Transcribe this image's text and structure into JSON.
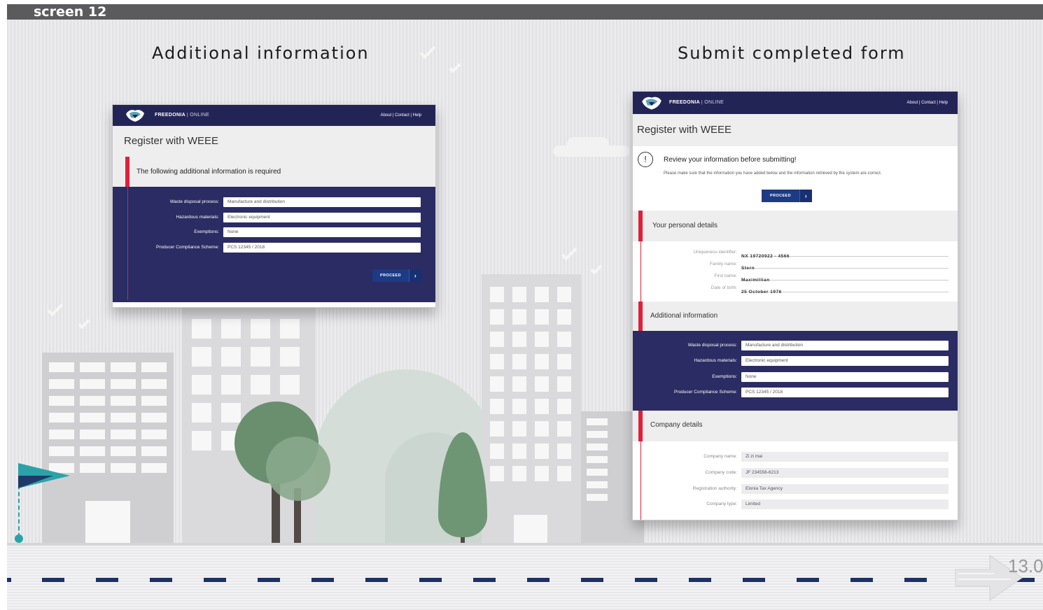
{
  "slide": {
    "screen_label": "screen 12",
    "page_number": "13.0"
  },
  "left_panel": {
    "heading": "Additional information",
    "app": {
      "brand": "FREEDONIA",
      "brand_sub": "| ONLINE",
      "header_links": "About | Contact | Help",
      "page_title": "Register with WEEE",
      "notice": "The following additional information is required",
      "fields": [
        {
          "label": "Waste disposal process:",
          "value": "Manufacture and distribution"
        },
        {
          "label": "Hazardous materials:",
          "value": "Electronic equipment"
        },
        {
          "label": "Exemptions:",
          "value": "None"
        },
        {
          "label": "Producer Compliance Scheme:",
          "value": "PCS 12345 / 2018"
        }
      ],
      "button_label": "PROCEED",
      "button_chevron": "›"
    }
  },
  "right_panel": {
    "heading": "Submit completed form",
    "app": {
      "brand": "FREEDONIA",
      "brand_sub": "| ONLINE",
      "header_links": "About | Contact | Help",
      "page_title": "Register with WEEE",
      "review_icon": "!",
      "review_title": "Review your information before submitting!",
      "review_text": "Please make sure that the information you have added below and the information retrieved by the system are correct.",
      "button_label": "PROCEED",
      "button_chevron": "›",
      "personal_title": "Your personal details",
      "personal": [
        {
          "label": "Uniqueness identifier:",
          "value": "NX 19720922 - 4566"
        },
        {
          "label": "Family name:",
          "value": "Stern"
        },
        {
          "label": "First name:",
          "value": "Maximillian"
        },
        {
          "label": "Date of birth:",
          "value": "25 October 1976"
        }
      ],
      "additional_title": "Additional information",
      "additional": [
        {
          "label": "Waste disposal process:",
          "value": "Manufacture and distribution"
        },
        {
          "label": "Hazardous materials:",
          "value": "Electronic equipment"
        },
        {
          "label": "Exemptions:",
          "value": "None"
        },
        {
          "label": "Producer Compliance Scheme:",
          "value": "PCS 12345 / 2018"
        }
      ],
      "company_title": "Company details",
      "company": [
        {
          "label": "Company name:",
          "value": "Zi zi mai"
        },
        {
          "label": "Company code:",
          "value": "JF 234556-6213"
        },
        {
          "label": "Registration authority:",
          "value": "Elonia Tax Agency"
        },
        {
          "label": "Company type:",
          "value": "Limited"
        }
      ]
    }
  },
  "colors": {
    "navy": "#232456",
    "form_navy": "#2a2c63",
    "button": "#1d3a84",
    "accent_red": "#e0203a",
    "road_dash": "#1e3163",
    "flag": "#2aa3a8"
  },
  "icons": [
    "freedonia-logo-icon",
    "chevron-right-icon",
    "warning-circle-icon",
    "flag-icon",
    "next-arrow-icon"
  ]
}
